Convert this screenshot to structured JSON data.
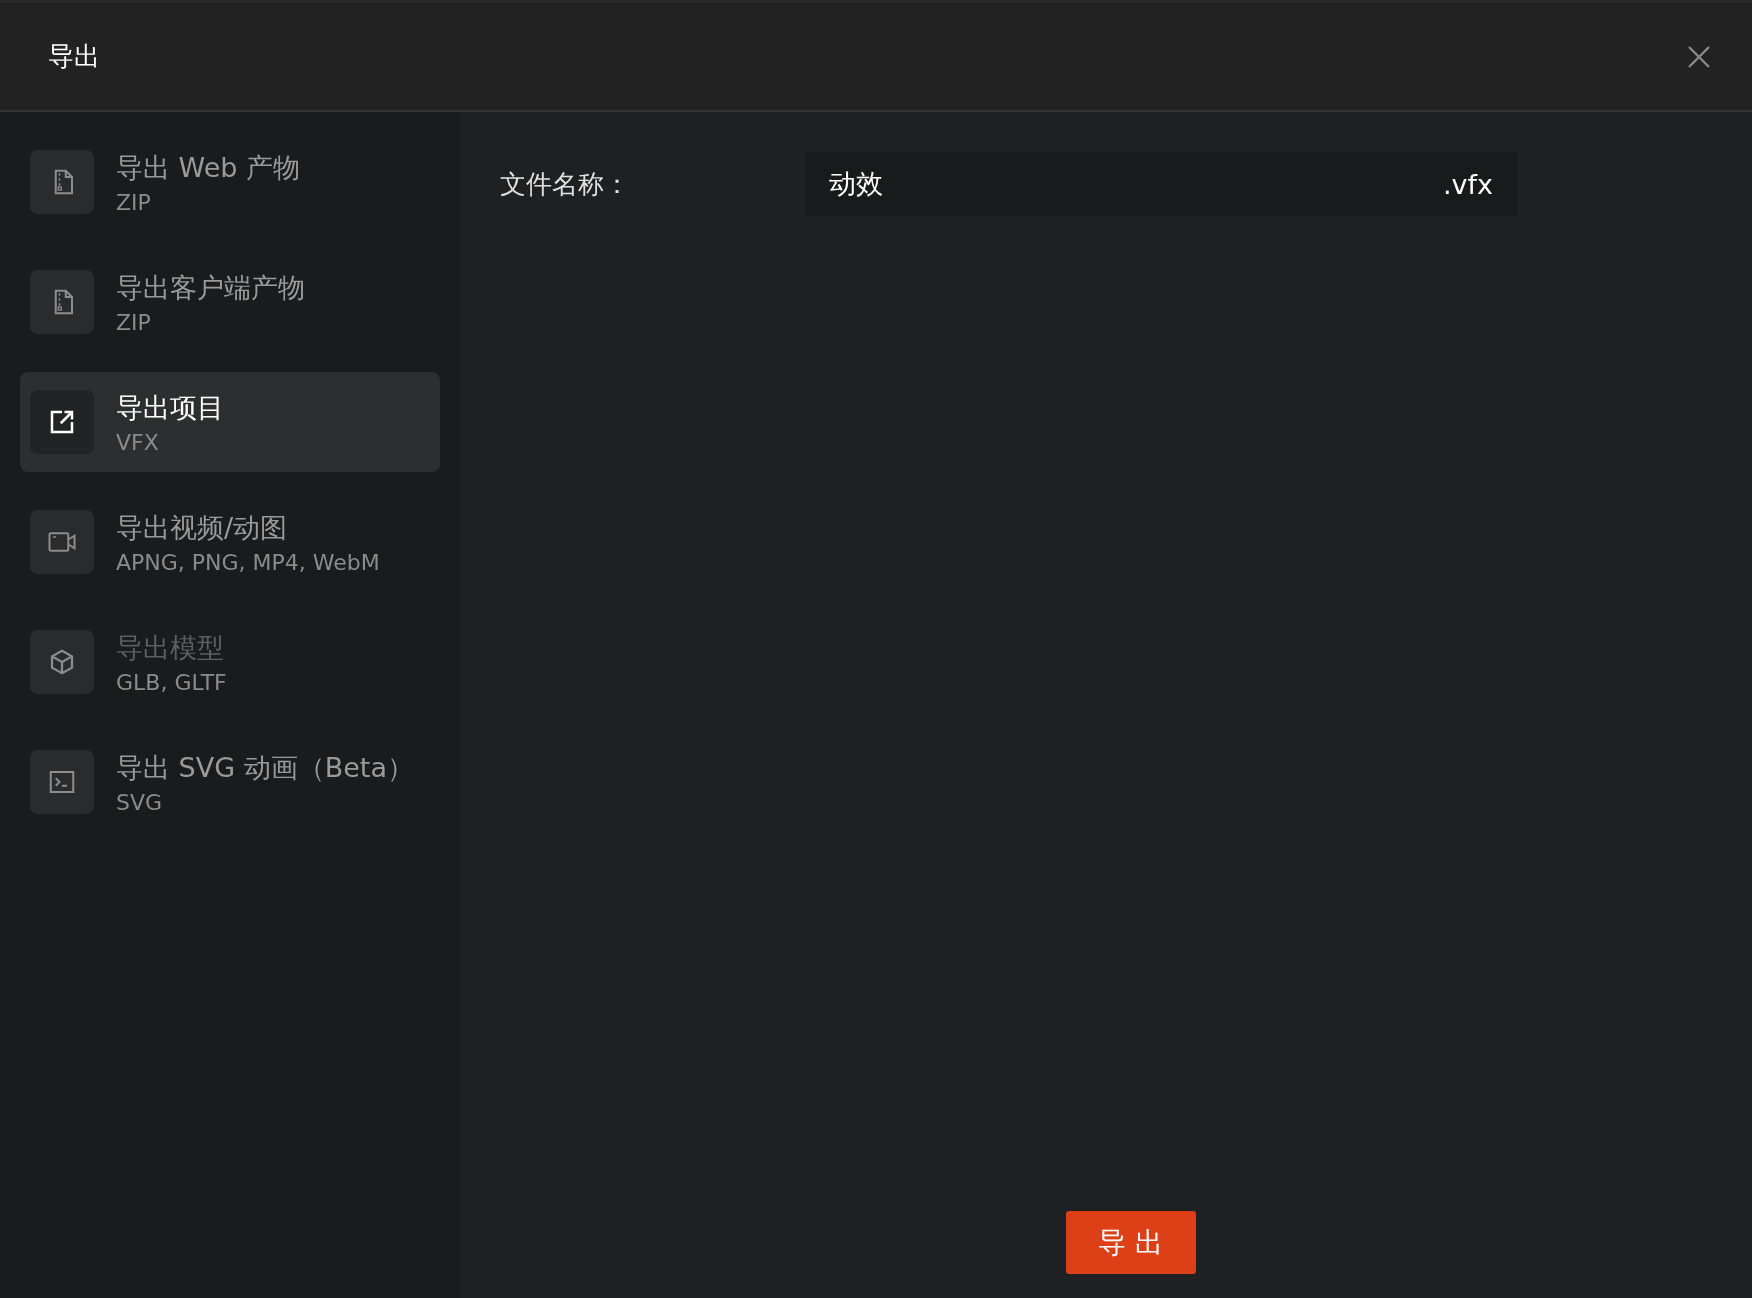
{
  "dialog": {
    "title": "导出"
  },
  "export_options": [
    {
      "title": "导出 Web 产物",
      "formats": "ZIP",
      "kind": "zip",
      "selected": false,
      "disabled": false
    },
    {
      "title": "导出客户端产物",
      "formats": "ZIP",
      "kind": "zip",
      "selected": false,
      "disabled": false
    },
    {
      "title": "导出项目",
      "formats": "VFX",
      "kind": "project",
      "selected": true,
      "disabled": false
    },
    {
      "title": "导出视频/动图",
      "formats": "APNG, PNG, MP4, WebM",
      "kind": "video",
      "selected": false,
      "disabled": false
    },
    {
      "title": "导出模型",
      "formats": "GLB, GLTF",
      "kind": "model",
      "selected": false,
      "disabled": true
    },
    {
      "title": "导出 SVG 动画（Beta）",
      "formats": "SVG",
      "kind": "svg",
      "selected": false,
      "disabled": false
    }
  ],
  "filename": {
    "label": "文件名称：",
    "value": "动效",
    "extension": ".vfx"
  },
  "export_button": "导 出"
}
